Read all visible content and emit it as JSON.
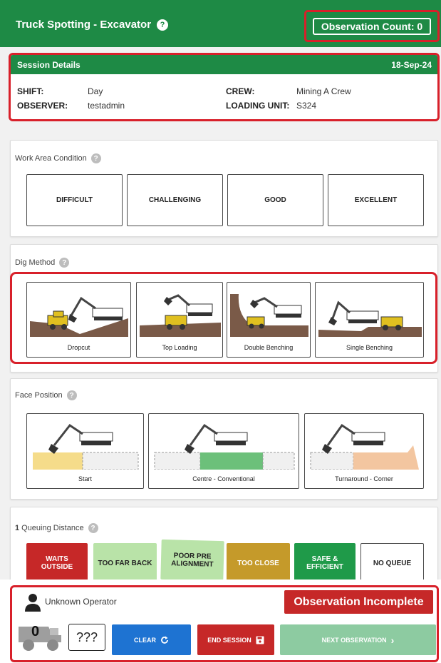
{
  "header": {
    "title": "Truck Spotting - Excavator",
    "help_glyph": "?",
    "observation_count_label": "Observation Count: 0"
  },
  "session": {
    "title": "Session Details",
    "date": "18-Sep-24",
    "shift_label": "SHIFT:",
    "shift_value": "Day",
    "observer_label": "OBSERVER:",
    "observer_value": "testadmin",
    "crew_label": "CREW:",
    "crew_value": "Mining A Crew",
    "loading_unit_label": "LOADING UNIT:",
    "loading_unit_value": "S324"
  },
  "work_area": {
    "title": "Work Area Condition",
    "options": [
      "DIFFICULT",
      "CHALLENGING",
      "GOOD",
      "EXCELLENT"
    ]
  },
  "dig_method": {
    "title": "Dig Method",
    "options": [
      "Dropcut",
      "Top Loading",
      "Double Benching",
      "Single Benching"
    ]
  },
  "face_position": {
    "title": "Face Position",
    "options": [
      "Start",
      "Centre - Conventional",
      "Turnaround - Corner"
    ]
  },
  "queuing": {
    "number": "1",
    "title": "Queuing Distance",
    "options": [
      {
        "label": "WAITS OUTSIDE",
        "color": "#c62828",
        "text_color": "#ffffff"
      },
      {
        "label": "TOO FAR BACK",
        "color": "#b9e3a8",
        "text_color": "#222222"
      },
      {
        "label": "POOR PRE ALIGNMENT",
        "color": "#b9e3a8",
        "text_color": "#222222"
      },
      {
        "label": "TOO CLOSE",
        "color": "#c59a2a",
        "text_color": "#ffffff"
      },
      {
        "label": "SAFE & EFFICIENT",
        "color": "#1f9a49",
        "text_color": "#ffffff"
      },
      {
        "label": "NO QUEUE",
        "color": "#ffffff",
        "text_color": "#222222"
      }
    ]
  },
  "footer": {
    "operator_label": "Unknown Operator",
    "status_label": "Observation Incomplete",
    "truck_count": "0",
    "unknown_label": "???",
    "clear_label": "CLEAR",
    "end_session_label": "END SESSION",
    "next_label": "NEXT OBSERVATION",
    "next_glyph": "›"
  },
  "colors": {
    "brand_green": "#1e8a45",
    "highlight_red": "#d8202a",
    "clear_blue": "#1e73d2",
    "end_red": "#c62828",
    "next_green": "#8dcba1"
  }
}
